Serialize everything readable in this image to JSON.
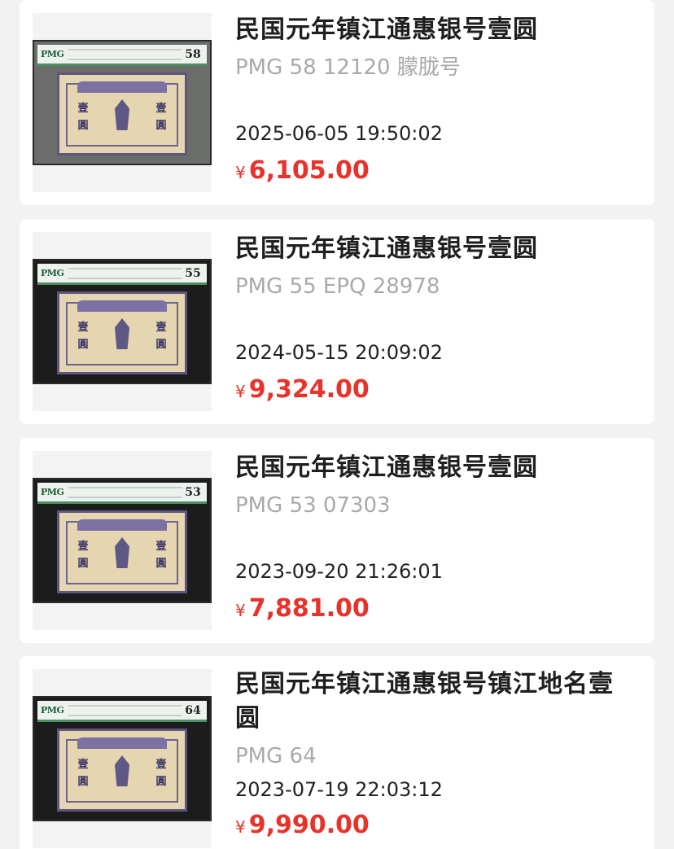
{
  "items": [
    {
      "title": "民国元年镇江通惠银号壹圆",
      "subtitle": "PMG 58 12120 朦胧号",
      "date": "2025-06-05 19:50:02",
      "currency": "¥",
      "price": "6,105.00",
      "grade": "58",
      "slab_color": "#6b6d6b",
      "image_icon": "banknote-image"
    },
    {
      "title": "民国元年镇江通惠银号壹圆",
      "subtitle": "PMG 55 EPQ  28978",
      "date": "2024-05-15 20:09:02",
      "currency": "¥",
      "price": "9,324.00",
      "grade": "55",
      "slab_color": "#1c1c1c",
      "image_icon": "banknote-image"
    },
    {
      "title": "民国元年镇江通惠银号壹圆",
      "subtitle": "PMG 53 07303",
      "date": "2023-09-20 21:26:01",
      "currency": "¥",
      "price": "7,881.00",
      "grade": "53",
      "slab_color": "#1c1c1c",
      "image_icon": "banknote-image"
    },
    {
      "title": "民国元年镇江通惠银号镇江地名壹圆",
      "subtitle": "PMG 64",
      "date": "2023-07-19 22:03:12",
      "currency": "¥",
      "price": "9,990.00",
      "grade": "64",
      "slab_color": "#1c1c1c",
      "image_icon": "banknote-image"
    }
  ],
  "colors": {
    "price": "#e8332b",
    "subtitle": "#a9a9a9",
    "background": "#f2f2f2"
  }
}
